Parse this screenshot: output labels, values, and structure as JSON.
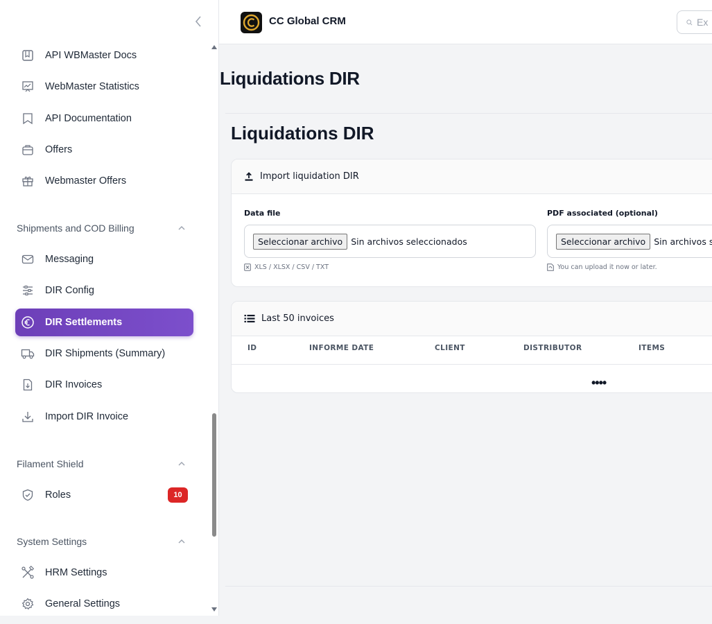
{
  "app": {
    "title": "CC Global CRM",
    "search_placeholder": "Ex"
  },
  "sidebar": {
    "items_top": [
      {
        "label": "API WBMaster Docs",
        "icon": "book-icon"
      },
      {
        "label": "WebMaster Statistics",
        "icon": "chart-icon"
      },
      {
        "label": "API Documentation",
        "icon": "bookmark-icon"
      },
      {
        "label": "Offers",
        "icon": "briefcase-icon"
      },
      {
        "label": "Webmaster Offers",
        "icon": "gift-icon"
      }
    ],
    "groups": [
      {
        "label": "Shipments and COD Billing",
        "items": [
          {
            "label": "Messaging",
            "icon": "envelope-icon"
          },
          {
            "label": "DIR Config",
            "icon": "sliders-icon"
          },
          {
            "label": "DIR Settlements",
            "icon": "euro-icon",
            "active": true
          },
          {
            "label": "DIR Shipments (Summary)",
            "icon": "truck-icon"
          },
          {
            "label": "DIR Invoices",
            "icon": "document-download-icon"
          },
          {
            "label": "Import DIR Invoice",
            "icon": "download-icon"
          }
        ]
      },
      {
        "label": "Filament Shield",
        "items": [
          {
            "label": "Roles",
            "icon": "shield-check-icon",
            "badge": "10"
          }
        ]
      },
      {
        "label": "System Settings",
        "items": [
          {
            "label": "HRM Settings",
            "icon": "tools-icon"
          },
          {
            "label": "General Settings",
            "icon": "cog-icon"
          }
        ]
      }
    ]
  },
  "page": {
    "title": "Liquidations DIR",
    "section_title": "Liquidations DIR"
  },
  "import_card": {
    "heading": "Import liquidation DIR",
    "data_file": {
      "label": "Data file",
      "button": "Seleccionar archivo",
      "status": "Sin archivos seleccionados",
      "hint": "XLS / XLSX / CSV / TXT"
    },
    "pdf_file": {
      "label": "PDF associated (optional)",
      "button": "Seleccionar archivo",
      "status": "Sin archivos seleccionados",
      "hint": "You can upload it now or later."
    }
  },
  "invoices_card": {
    "heading": "Last 50 invoices",
    "columns": [
      "ID",
      "INFORME DATE",
      "CLIENT",
      "DISTRIBUTOR",
      "ITEMS"
    ],
    "loading": "••••"
  },
  "colors": {
    "accent": "#6d3fb8",
    "badge": "#dc2626"
  }
}
